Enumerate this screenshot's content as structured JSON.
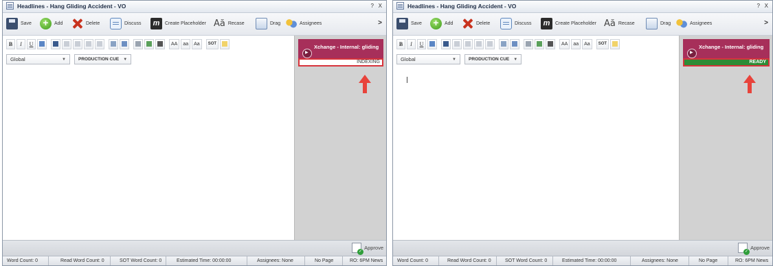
{
  "panels": [
    {
      "title": "Headlines - Hang Gliding Accident - VO",
      "title_buttons": {
        "help": "?",
        "close": "X"
      },
      "toolbar": {
        "save": "Save",
        "add": "Add",
        "delete": "Delete",
        "discuss": "Discuss",
        "create_placeholder": "Create Placeholder",
        "recase_glyph": "Aă",
        "recase": "Recase",
        "drag": "Drag",
        "assignees": "Assignees",
        "more": ">"
      },
      "format": {
        "bold": "B",
        "italic": "I",
        "underline": "U",
        "caps1": "AA",
        "caps2": "aa",
        "caps3": "Aa",
        "sot": "SOT"
      },
      "selects": {
        "scope": "Global",
        "cue": "PRODUCTION CUE"
      },
      "media": {
        "title": "Xchange - Internal: gliding",
        "status": "INDEXING"
      },
      "approve": "Approve",
      "status": {
        "word_count": "Word Count: 0",
        "read_word_count": "Read Word Count: 0",
        "sot_word_count": "SOT Word Count: 0",
        "estimated_time": "Estimated Time: 00:00:00",
        "assignees": "Assignees: None",
        "page": "No Page",
        "rundown": "RO: 6PM News"
      }
    },
    {
      "title": "Headlines - Hang Gliding Accident - VO",
      "title_buttons": {
        "help": "?",
        "close": "X"
      },
      "toolbar": {
        "save": "Save",
        "add": "Add",
        "delete": "Delete",
        "discuss": "Discuss",
        "create_placeholder": "Create Placeholder",
        "recase_glyph": "Aă",
        "recase": "Recase",
        "drag": "Drag",
        "assignees": "Assignees",
        "more": ">"
      },
      "format": {
        "bold": "B",
        "italic": "I",
        "underline": "U",
        "caps1": "AA",
        "caps2": "aa",
        "caps3": "Aa",
        "sot": "SOT"
      },
      "selects": {
        "scope": "Global",
        "cue": "PRODUCTION CUE"
      },
      "media": {
        "title": "Xchange - Internal: gliding",
        "status": "READY"
      },
      "approve": "Approve",
      "status": {
        "word_count": "Word Count: 0",
        "read_word_count": "Read Word Count: 0",
        "sot_word_count": "SOT Word Count: 0",
        "estimated_time": "Estimated Time: 00:00:00",
        "assignees": "Assignees: None",
        "page": "No Page",
        "rundown": "RO: 6PM News"
      }
    }
  ],
  "colors": {
    "media_card": "#a72f5a",
    "ready_status": "#2d8c36",
    "highlight_border": "#d7333b",
    "arrow": "#e8433b"
  }
}
